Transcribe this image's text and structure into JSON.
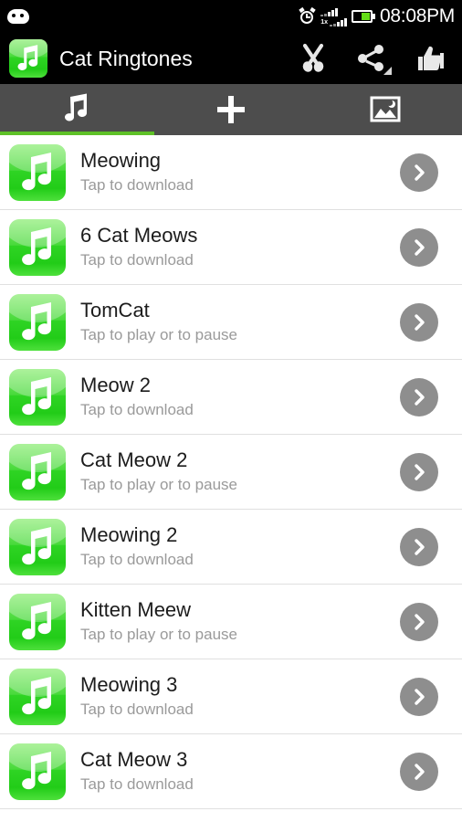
{
  "status_bar": {
    "notification_icon": "android-robot-icon",
    "alarm_icon": "alarm-clock-icon",
    "network_label": "1x",
    "battery_icon": "battery-icon",
    "time": "08:08PM",
    "accent_battery_color": "#64dd17"
  },
  "action_bar": {
    "logo_icon": "music-note-app-icon",
    "title": "Cat Ringtones",
    "actions": [
      {
        "name": "cut-button",
        "icon": "scissors-icon"
      },
      {
        "name": "share-button",
        "icon": "share-icon"
      },
      {
        "name": "rate-button",
        "icon": "thumbs-up-icon"
      }
    ]
  },
  "tabs": {
    "active_index": 0,
    "active_color": "#5ec127",
    "items": [
      {
        "name": "tab-ringtones",
        "icon": "music-note-icon"
      },
      {
        "name": "tab-add",
        "icon": "plus-icon"
      },
      {
        "name": "tab-wallpapers",
        "icon": "image-icon"
      }
    ]
  },
  "list": {
    "rows": [
      {
        "title": "Meowing",
        "subtitle": "Tap to download",
        "icon": "music-note-tile",
        "arrow": "chevron-right-icon"
      },
      {
        "title": "6 Cat Meows",
        "subtitle": "Tap to download",
        "icon": "music-note-tile",
        "arrow": "chevron-right-icon"
      },
      {
        "title": "TomCat",
        "subtitle": "Tap to play or to pause",
        "icon": "music-note-tile",
        "arrow": "chevron-right-icon"
      },
      {
        "title": "Meow 2",
        "subtitle": "Tap to download",
        "icon": "music-note-tile",
        "arrow": "chevron-right-icon"
      },
      {
        "title": "Cat Meow 2",
        "subtitle": "Tap to play or to pause",
        "icon": "music-note-tile",
        "arrow": "chevron-right-icon"
      },
      {
        "title": "Meowing 2",
        "subtitle": "Tap to download",
        "icon": "music-note-tile",
        "arrow": "chevron-right-icon"
      },
      {
        "title": "Kitten Meew",
        "subtitle": "Tap to play or to pause",
        "icon": "music-note-tile",
        "arrow": "chevron-right-icon"
      },
      {
        "title": "Meowing 3",
        "subtitle": "Tap to download",
        "icon": "music-note-tile",
        "arrow": "chevron-right-icon"
      },
      {
        "title": "Cat Meow 3",
        "subtitle": "Tap to download",
        "icon": "music-note-tile",
        "arrow": "chevron-right-icon"
      }
    ]
  }
}
